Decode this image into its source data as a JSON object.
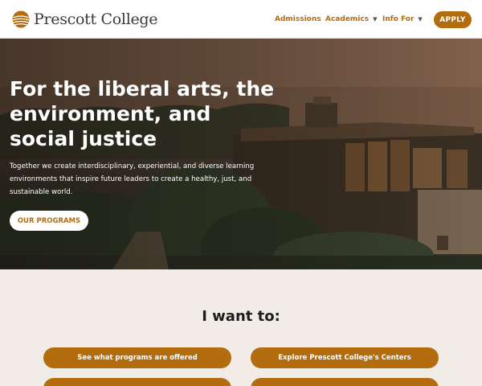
{
  "header": {
    "logo_text": "Prescott College",
    "nav": [
      {
        "label": "Admissions",
        "has_dropdown": false
      },
      {
        "label": "Academics",
        "has_dropdown": true
      },
      {
        "label": "Info For",
        "has_dropdown": true
      }
    ],
    "apply_label": "APPLY"
  },
  "hero": {
    "title": "For the liberal arts, the environment, and social justice",
    "subtitle": "Together we create interdisciplinary, experiential, and diverse learning environments that inspire future leaders to create a healthy, just, and sustainable world.",
    "button_label": "OUR PROGRAMS"
  },
  "want": {
    "title": "I want to:",
    "buttons": [
      "See what programs are offered",
      "Explore Prescott College's Centers"
    ]
  },
  "colors": {
    "accent": "#b36d0f",
    "page_bg": "#f1ece6"
  }
}
